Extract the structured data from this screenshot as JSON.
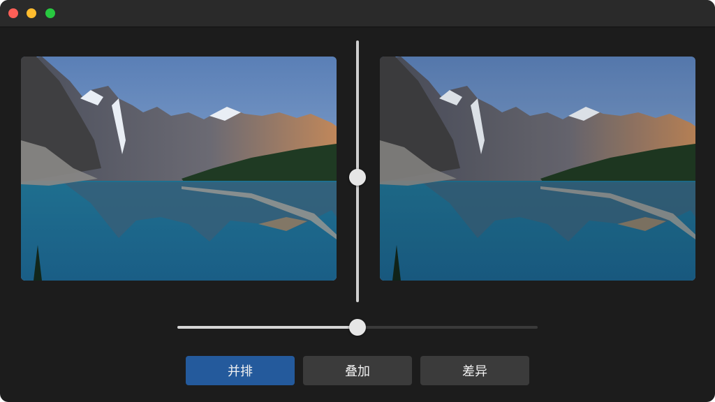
{
  "controls": {
    "compare_split_value": 0.5,
    "scrub_value": 0.5,
    "modes": [
      {
        "label": "并排",
        "active": true
      },
      {
        "label": "叠加",
        "active": false
      },
      {
        "label": "差异",
        "active": false
      }
    ]
  },
  "colors": {
    "active_button": "#245a9c",
    "inactive_button": "#3b3b3b",
    "window_bg": "#1c1c1c"
  }
}
